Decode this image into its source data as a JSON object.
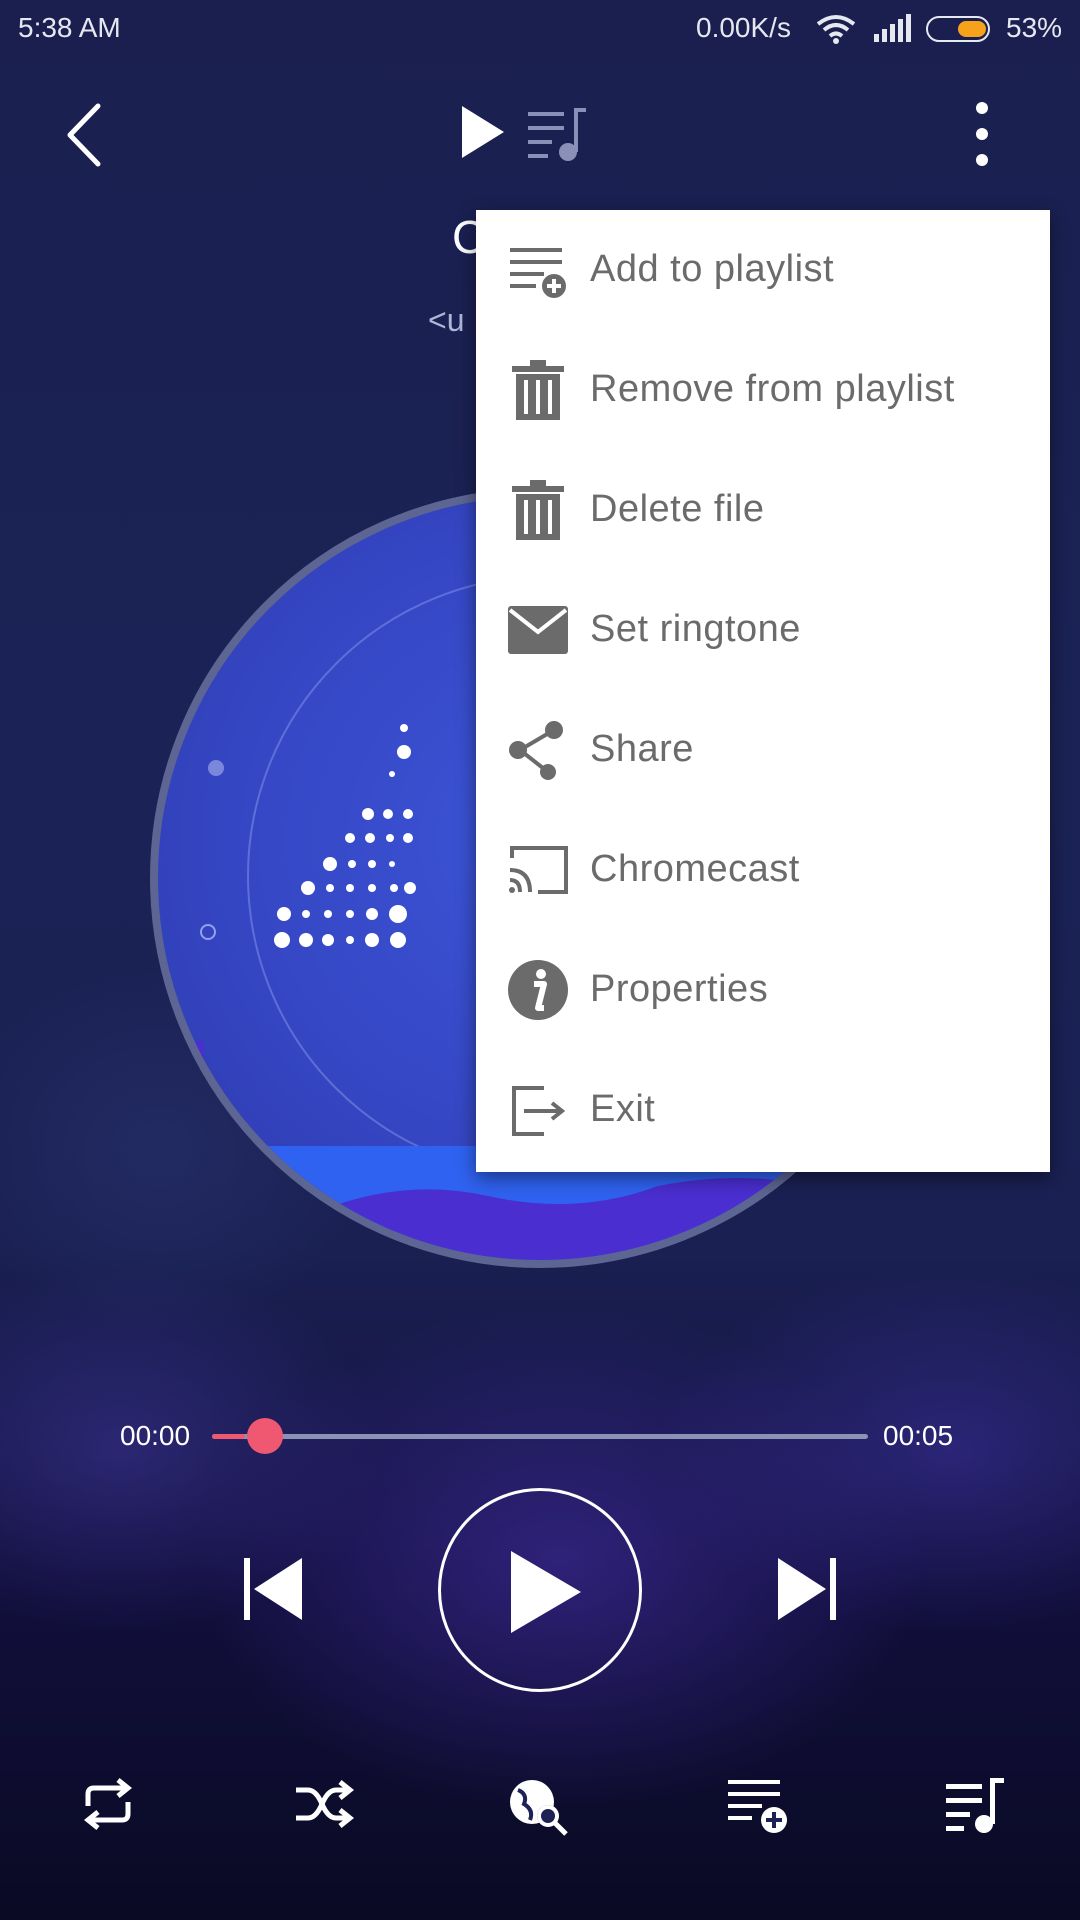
{
  "status_bar": {
    "time": "5:38 AM",
    "net_speed": "0.00K/s",
    "battery_percent": "53%",
    "battery_level": 0.53,
    "battery_color": "#f7a21b"
  },
  "top_bar": {
    "icons": [
      "back-arrow-icon",
      "play-icon",
      "queue-music-icon",
      "more-vert-icon"
    ]
  },
  "song": {
    "title_visible": "C",
    "artist_visible": "<u"
  },
  "menu": {
    "items": [
      {
        "label": "Add to playlist",
        "icon": "playlist-add-icon"
      },
      {
        "label": "Remove from playlist",
        "icon": "trash-icon"
      },
      {
        "label": "Delete file",
        "icon": "trash-icon"
      },
      {
        "label": "Set ringtone",
        "icon": "envelope-icon"
      },
      {
        "label": "Share",
        "icon": "share-icon"
      },
      {
        "label": "Chromecast",
        "icon": "cast-icon"
      },
      {
        "label": "Properties",
        "icon": "info-icon"
      },
      {
        "label": "Exit",
        "icon": "exit-icon"
      }
    ]
  },
  "player": {
    "current_time": "00:00",
    "total_time": "00:05",
    "progress": 0.05,
    "accent": "#ef5870"
  },
  "bottom_bar": {
    "icons": [
      "repeat-icon",
      "shuffle-icon",
      "search-lyrics-icon",
      "playlist-add-icon",
      "queue-music-icon"
    ]
  }
}
